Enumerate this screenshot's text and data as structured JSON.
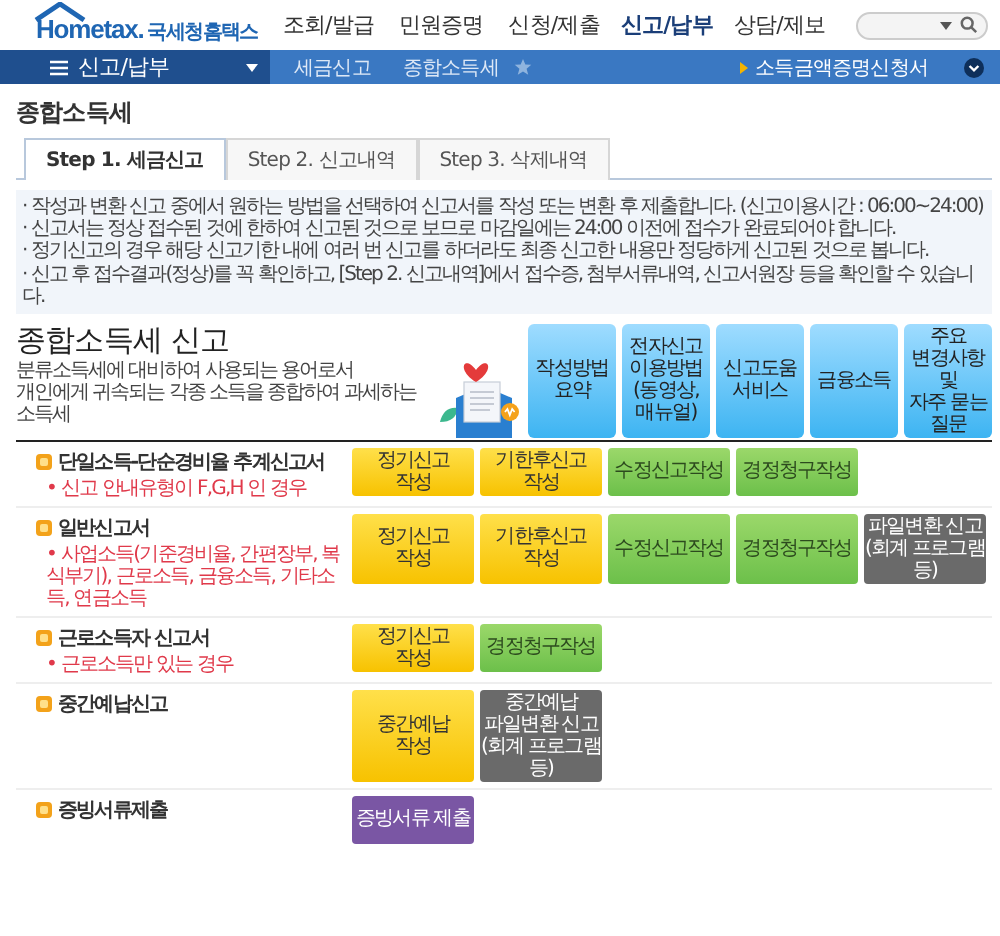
{
  "header": {
    "logo": {
      "brand": "Hometax.",
      "name": "국세청홈택스"
    },
    "menu": [
      {
        "label": "조회/발급",
        "selected": false
      },
      {
        "label": "민원증명",
        "selected": false
      },
      {
        "label": "신청/제출",
        "selected": false
      },
      {
        "label": "신고/납부",
        "selected": true
      },
      {
        "label": "상담/제보",
        "selected": false
      }
    ]
  },
  "nav": {
    "section": "신고/납부",
    "breadcrumbs": [
      "세금신고",
      "종합소득세"
    ],
    "quick_link": "소득금액증명신청서"
  },
  "page_title": "종합소득세",
  "tabs": [
    {
      "label": "Step 1. 세금신고",
      "selected": true
    },
    {
      "label": "Step 2. 신고내역",
      "selected": false
    },
    {
      "label": "Step 3. 삭제내역",
      "selected": false
    }
  ],
  "notices": [
    "· 작성과 변환 신고 중에서 원하는 방법을 선택하여 신고서를 작성 또는 변환 후 제출합니다. (신고이용시간 : 06:00~24:00)",
    "· 신고서는 정상 접수된 것에 한하여 신고된 것으로 보므로 마감일에는 24:00 이전에 접수가 완료되어야 합니다.",
    "· 정기신고의 경우 해당 신고기한 내에 여러 번 신고를 하더라도 최종 신고한 내용만 정당하게 신고된 것으로 봅니다.",
    "· 신고 후 접수결과(정상)를 꼭 확인하고, [Step 2. 신고내역]에서 접수증, 첨부서류내역, 신고서원장 등을 확인할 수 있습니다."
  ],
  "banner": {
    "title": "종합소득세 신고",
    "description": "분류소득세에 대비하여 사용되는 용어로서\n개인에게 귀속되는 각종 소득을 종합하여 과세하는 소득세",
    "links": [
      "작성방법\n요약",
      "전자신고\n이용방법\n(동영상,\n매뉴얼)",
      "신고도움\n서비스",
      "금융소득",
      "주요\n변경사항 및\n자주 묻는\n질문"
    ]
  },
  "forms": [
    {
      "title": "단일소득-단순경비율 추계신고서",
      "note": "• 신고 안내유형이 F,G,H 인 경우",
      "buttons": [
        {
          "label": "정기신고\n작성",
          "kind": "regular"
        },
        {
          "label": "기한후신고\n작성",
          "kind": "regular"
        },
        {
          "label": "수정신고작성",
          "kind": "amend"
        },
        {
          "label": "경정청구작성",
          "kind": "amend"
        }
      ]
    },
    {
      "title": "일반신고서",
      "note": "• 사업소득(기준경비율, 간편장부, 복식부기), 근로소득, 금융소득, 기타소득, 연금소득",
      "buttons": [
        {
          "label": "정기신고\n작성",
          "kind": "regular"
        },
        {
          "label": "기한후신고\n작성",
          "kind": "regular"
        },
        {
          "label": "수정신고작성",
          "kind": "amend"
        },
        {
          "label": "경정청구작성",
          "kind": "amend"
        },
        {
          "label": "파일변환 신고\n(회계 프로그램 등)",
          "kind": "file"
        }
      ]
    },
    {
      "title": "근로소득자 신고서",
      "note": "• 근로소득만 있는 경우",
      "buttons": [
        {
          "label": "정기신고\n작성",
          "kind": "regular"
        },
        {
          "label": "경정청구작성",
          "kind": "amend"
        }
      ]
    },
    {
      "title": "중간예납신고",
      "buttons": [
        {
          "label": "중간예납\n작성",
          "kind": "regular"
        },
        {
          "label": "중간예납\n파일변환 신고\n(회계 프로그램 등)",
          "kind": "file"
        }
      ]
    },
    {
      "title": "증빙서류제출",
      "buttons": [
        {
          "label": "증빙서류 제출",
          "kind": "submit"
        }
      ]
    }
  ]
}
